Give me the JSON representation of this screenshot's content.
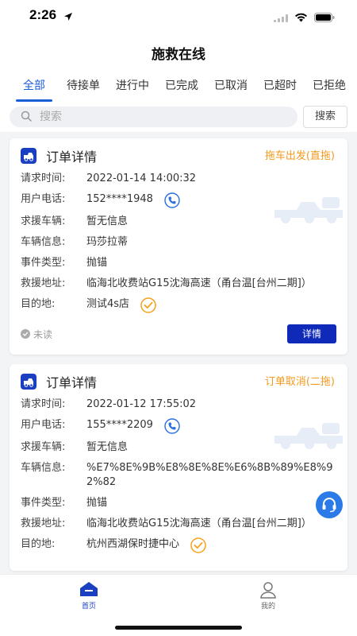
{
  "status": {
    "time": "2:26"
  },
  "nav": {
    "title": "施救在线"
  },
  "tabs": [
    {
      "label": "全部"
    },
    {
      "label": "待接单"
    },
    {
      "label": "进行中"
    },
    {
      "label": "已完成"
    },
    {
      "label": "已取消"
    },
    {
      "label": "已超时"
    },
    {
      "label": "已拒绝"
    }
  ],
  "search": {
    "placeholder": "搜索",
    "button_label": "搜索"
  },
  "labels": {
    "request_time": "请求时间:",
    "phone": "用户电话:",
    "vehicle": "求援车辆:",
    "vehicle_info": "车辆信息:",
    "event_type": "事件类型:",
    "rescue_address": "救援地址:",
    "destination": "目的地:"
  },
  "orders": [
    {
      "title": "订单详情",
      "status": "拖车出发(直拖)",
      "request_time": "2022-01-14 14:00:32",
      "phone": "152****1948",
      "vehicle": "暂无信息",
      "vehicle_info": "玛莎拉蒂",
      "event_type": "抛锚",
      "rescue_address": "临海北收费站G15沈海高速（甬台温[台州二期]）",
      "destination": "测试4s店",
      "read_status": "未读",
      "detail_label": "详情"
    },
    {
      "title": "订单详情",
      "status": "订单取消(二拖)",
      "request_time": "2022-01-12 17:55:02",
      "phone": "155****2209",
      "vehicle": "暂无信息",
      "vehicle_info": "%E7%8E%9B%E8%8E%8E%E6%8B%89%E8%92%82",
      "event_type": "抛锚",
      "rescue_address": "临海北收费站G15沈海高速（甬台温[台州二期]）",
      "destination": "杭州西湖保时捷中心"
    }
  ],
  "tabbar": [
    {
      "label": "首页",
      "icon": "home-icon"
    },
    {
      "label": "我的",
      "icon": "profile-icon"
    }
  ],
  "colors": {
    "accent": "#1a5fd8",
    "status_orange": "#f39a1c",
    "button_blue": "#0f2ab8"
  }
}
